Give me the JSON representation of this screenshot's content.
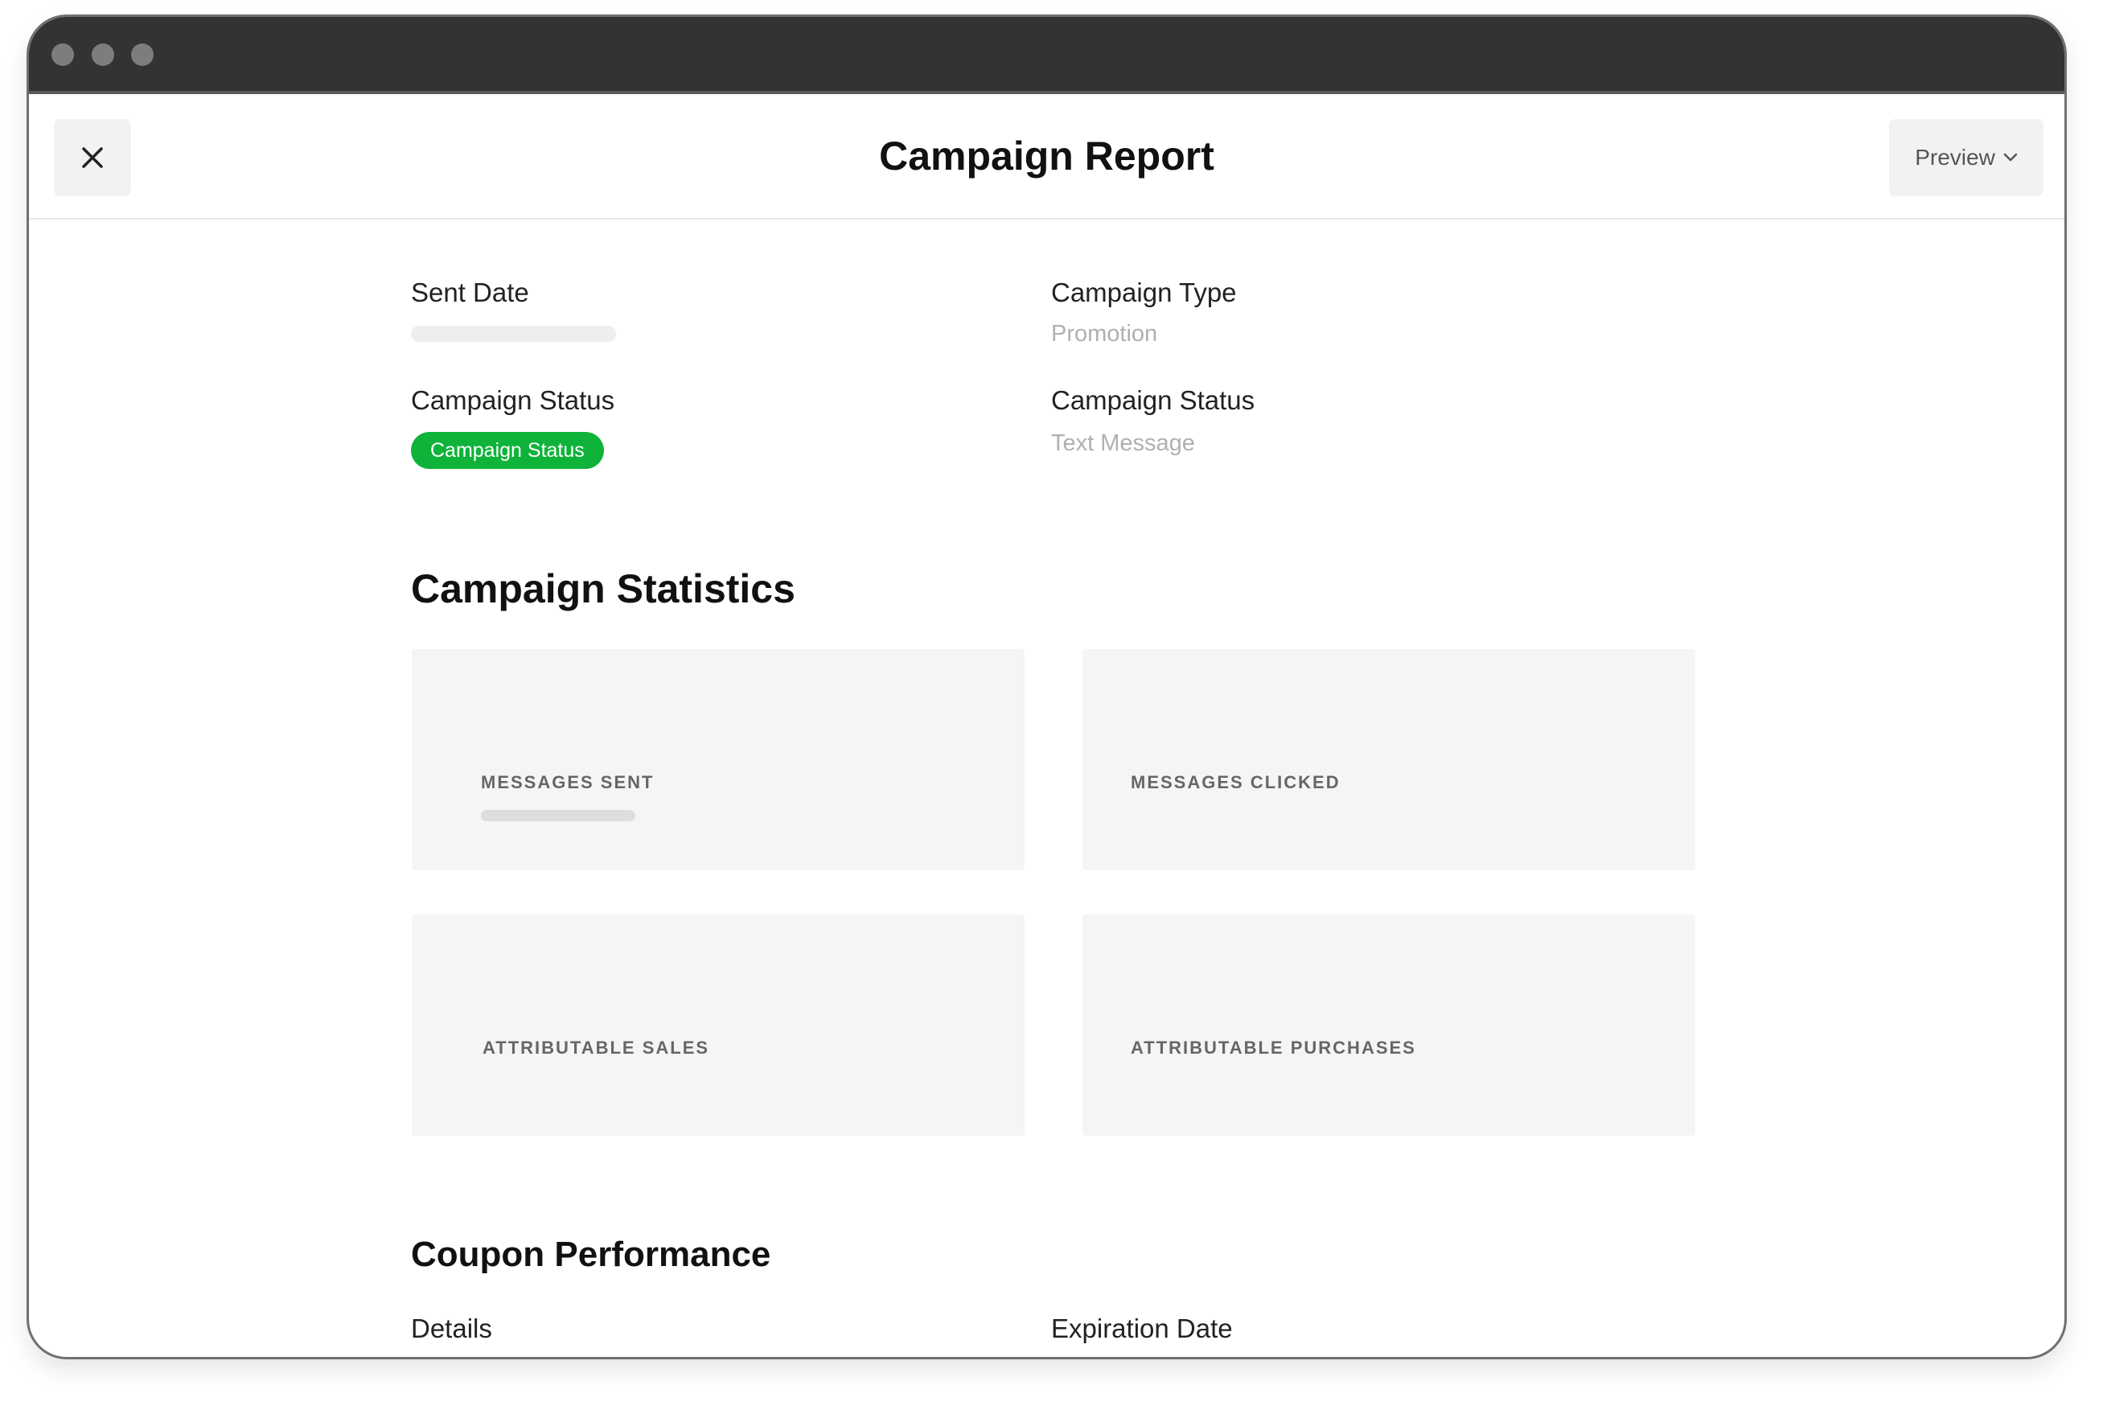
{
  "header": {
    "title": "Campaign Report",
    "close_icon": "close-icon",
    "preview_label": "Preview",
    "preview_icon": "chevron-down-icon"
  },
  "details": {
    "sent_date_label": "Sent Date",
    "campaign_type_label": "Campaign Type",
    "campaign_type_value": "Promotion",
    "campaign_status_label": "Campaign Status",
    "campaign_status_badge": "Campaign Status",
    "campaign_status_label_2": "Campaign Status",
    "campaign_status_value_2": "Text Message"
  },
  "statistics": {
    "title": "Campaign Statistics",
    "cards": [
      {
        "label": "MESSAGES SENT"
      },
      {
        "label": "MESSAGES CLICKED"
      },
      {
        "label": "ATTRIBUTABLE SALES"
      },
      {
        "label": "ATTRIBUTABLE PURCHASES"
      }
    ]
  },
  "coupon": {
    "title": "Coupon Performance",
    "details_label": "Details",
    "expiration_label": "Expiration Date"
  },
  "colors": {
    "status_badge": "#0fb33a",
    "titlebar": "#333333"
  }
}
